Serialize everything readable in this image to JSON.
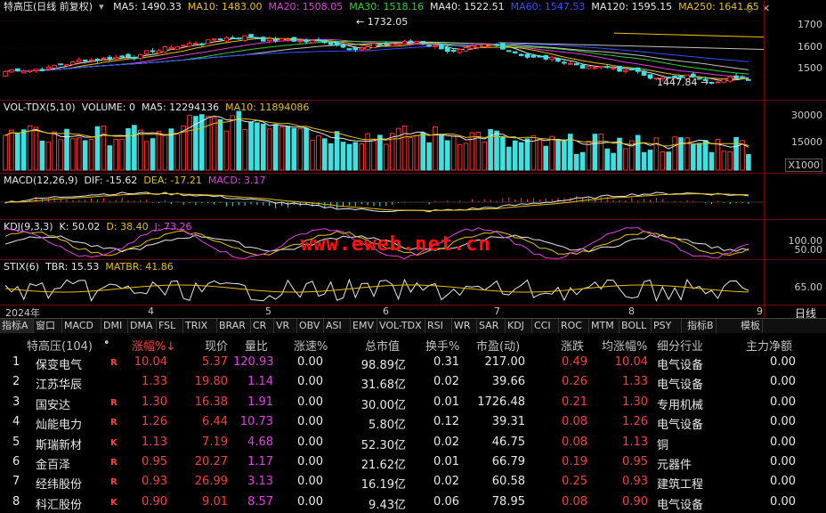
{
  "main_chart": {
    "title": "特高压(日线 前复权)",
    "ma": [
      {
        "label": "MA5: 1490.33",
        "color": "#e8e8e8"
      },
      {
        "label": "MA10: 1483.00",
        "color": "#e6c000"
      },
      {
        "label": "MA20: 1508.05",
        "color": "#e040e0"
      },
      {
        "label": "MA30: 1518.16",
        "color": "#30d030"
      },
      {
        "label": "MA40: 1522.51",
        "color": "#e8e8e8"
      },
      {
        "label": "MA60: 1547.53",
        "color": "#3050ff"
      },
      {
        "label": "MA120: 1595.15",
        "color": "#e8e8e8"
      },
      {
        "label": "MA250: 1641.65",
        "color": "#e6c000"
      }
    ],
    "high_label": "1732.05",
    "low_label": "1447.84",
    "axis": [
      "1700",
      "1600",
      "1500"
    ],
    "y_range": [
      1430,
      1750
    ]
  },
  "volume_chart": {
    "labels": [
      {
        "label": "VOL-TDX(5,10)",
        "color": "#e8e8e8"
      },
      {
        "label": "VOLUME: 0",
        "color": "#e8e8e8"
      },
      {
        "label": "MA5: 12294136",
        "color": "#e8e8e8"
      },
      {
        "label": "MA10: 11894086",
        "color": "#e6c000"
      }
    ],
    "axis": [
      "30000",
      "15000"
    ],
    "unit": "X1000"
  },
  "macd_chart": {
    "labels": [
      {
        "label": "MACD(12,26,9)",
        "color": "#e8e8e8"
      },
      {
        "label": "DIF: -15.62",
        "color": "#e8e8e8"
      },
      {
        "label": "DEA: -17.21",
        "color": "#e6c000"
      },
      {
        "label": "MACD: 3.17",
        "color": "#e040e0"
      }
    ]
  },
  "kdj_chart": {
    "labels": [
      {
        "label": "KDJ(9,3,3)",
        "color": "#e8e8e8"
      },
      {
        "label": "K: 50.02",
        "color": "#e8e8e8"
      },
      {
        "label": "D: 38.40",
        "color": "#e6c000"
      },
      {
        "label": "J: 73.26",
        "color": "#e040e0"
      }
    ],
    "axis": [
      "100.00",
      "50.00"
    ]
  },
  "stix_chart": {
    "labels": [
      {
        "label": "STIX(6)",
        "color": "#e8e8e8"
      },
      {
        "label": "TBR: 15.53",
        "color": "#e8e8e8"
      },
      {
        "label": "MATBR: 41.86",
        "color": "#e6c000"
      }
    ],
    "axis": [
      "65.00"
    ]
  },
  "watermark": "www.eweb.net.cn",
  "date_axis": {
    "year": "2024年",
    "months": [
      "4",
      "5",
      "6",
      "7",
      "8",
      "9"
    ],
    "period": "日线"
  },
  "tabs": [
    "指标A",
    "窗口",
    "MACD",
    "DMI",
    "DMA",
    "FSL",
    "TRIX",
    "BRAR",
    "CR",
    "VR",
    "OBV",
    "ASI",
    "EMV",
    "VOL-TDX",
    "RSI",
    "WR",
    "SAR",
    "KDJ",
    "CCI",
    "ROC",
    "MTM",
    "BOLL",
    "PSY"
  ],
  "tabs_right": [
    "指标B",
    "模板"
  ],
  "table": {
    "headers": [
      "特高压(104)",
      "•",
      "涨幅%↓",
      "现价",
      "量比",
      "涨速%",
      "总市值",
      "换手%",
      "市盈(动)",
      "涨跌",
      "均涨幅%",
      "细分行业",
      "主力净额"
    ],
    "rows": [
      {
        "no": "1",
        "name": "保变电气",
        "flag": "R",
        "chg": "10.04",
        "price": "5.37",
        "vr": "120.93",
        "speed": "0.00",
        "mcap": "98.89亿",
        "turn": "0.31",
        "pe": "217.00",
        "diff": "0.49",
        "avg": "10.04",
        "ind": "电气设备",
        "net": "0.00"
      },
      {
        "no": "2",
        "name": "江苏华辰",
        "flag": "",
        "chg": "1.33",
        "price": "19.80",
        "vr": "1.14",
        "speed": "0.00",
        "mcap": "31.68亿",
        "turn": "0.02",
        "pe": "39.66",
        "diff": "0.26",
        "avg": "1.33",
        "ind": "电气设备",
        "net": "0.00"
      },
      {
        "no": "3",
        "name": "国安达",
        "flag": "R",
        "chg": "1.30",
        "price": "16.38",
        "vr": "1.91",
        "speed": "0.00",
        "mcap": "30.00亿",
        "turn": "0.01",
        "pe": "1726.48",
        "diff": "0.21",
        "avg": "1.30",
        "ind": "专用机械",
        "net": "0.00"
      },
      {
        "no": "4",
        "name": "灿能电力",
        "flag": "R",
        "chg": "1.26",
        "price": "6.44",
        "vr": "10.73",
        "speed": "0.00",
        "mcap": "5.80亿",
        "turn": "0.12",
        "pe": "39.31",
        "diff": "0.08",
        "avg": "1.26",
        "ind": "电气设备",
        "net": "0.00"
      },
      {
        "no": "5",
        "name": "斯瑞新材",
        "flag": "K",
        "chg": "1.13",
        "price": "7.19",
        "vr": "4.68",
        "speed": "0.00",
        "mcap": "52.30亿",
        "turn": "0.02",
        "pe": "46.75",
        "diff": "0.08",
        "avg": "1.13",
        "ind": "铜",
        "net": "0.00"
      },
      {
        "no": "6",
        "name": "金百泽",
        "flag": "R",
        "chg": "0.95",
        "price": "20.27",
        "vr": "1.17",
        "speed": "0.00",
        "mcap": "21.62亿",
        "turn": "0.01",
        "pe": "66.79",
        "diff": "0.19",
        "avg": "0.95",
        "ind": "元器件",
        "net": "0.00"
      },
      {
        "no": "7",
        "name": "经纬股份",
        "flag": "R",
        "chg": "0.93",
        "price": "26.99",
        "vr": "3.13",
        "speed": "0.00",
        "mcap": "16.19亿",
        "turn": "0.02",
        "pe": "60.58",
        "diff": "0.25",
        "avg": "0.93",
        "ind": "建筑工程",
        "net": "0.00"
      },
      {
        "no": "8",
        "name": "科汇股份",
        "flag": "K",
        "chg": "0.90",
        "price": "9.01",
        "vr": "8.57",
        "speed": "0.00",
        "mcap": "9.43亿",
        "turn": "0.06",
        "pe": "78.95",
        "diff": "0.08",
        "avg": "0.90",
        "ind": "电气设备",
        "net": "0.00"
      }
    ]
  }
}
